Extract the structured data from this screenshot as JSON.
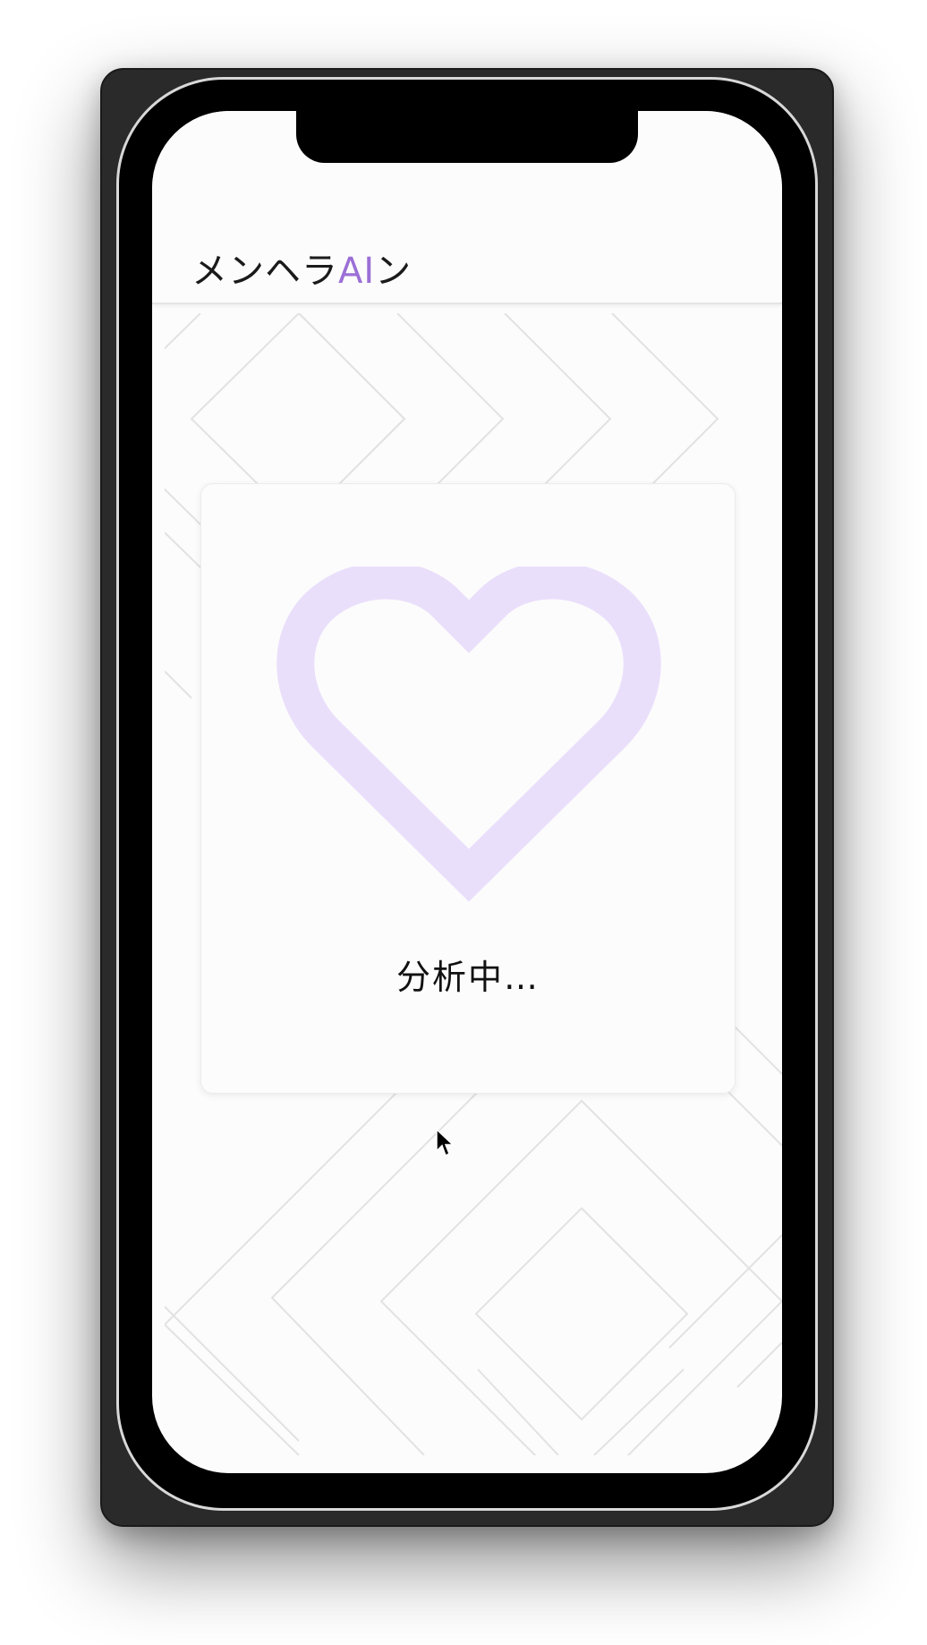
{
  "app": {
    "title_prefix": "メンヘラ",
    "title_accent": "AI",
    "title_suffix": "ン"
  },
  "loading": {
    "status_text": "分析中…"
  },
  "colors": {
    "accent": "#9b6fd6",
    "heart": "#eadffb",
    "pattern_line": "#e2e2e2"
  },
  "icons": {
    "heart": "heart-outline-icon",
    "cursor": "mouse-pointer-icon"
  }
}
